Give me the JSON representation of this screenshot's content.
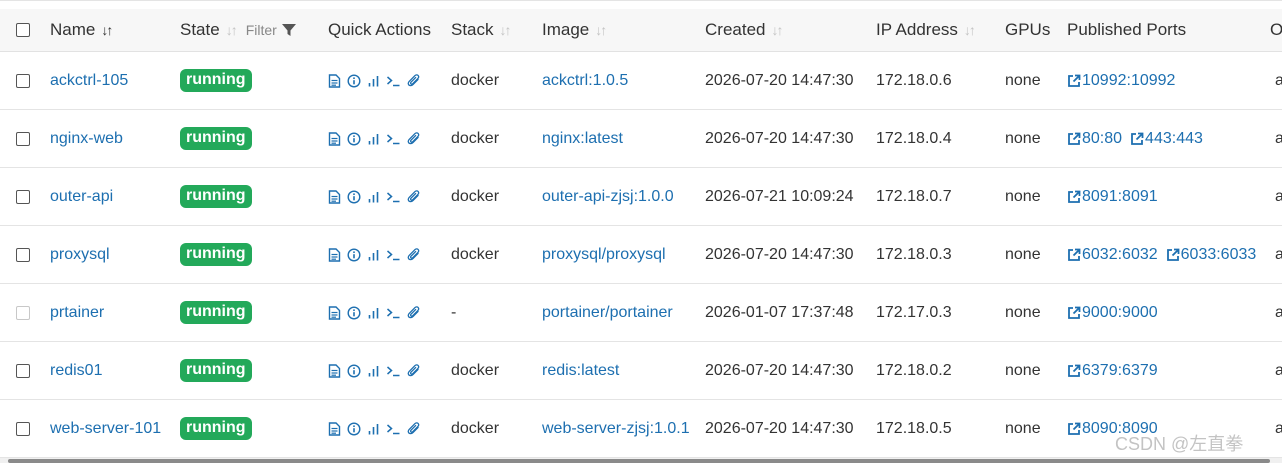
{
  "columns": {
    "name": "Name",
    "state": "State",
    "filter": "Filter",
    "quick_actions": "Quick Actions",
    "stack": "Stack",
    "image": "Image",
    "created": "Created",
    "ip": "IP Address",
    "gpus": "GPUs",
    "ports": "Published Ports",
    "owner_partial": "O"
  },
  "rows": [
    {
      "name": "ackctrl-105",
      "state": "running",
      "stack": "docker",
      "image": "ackctrl:1.0.5",
      "created": "2026-07-20 14:47:30",
      "ip": "172.18.0.6",
      "gpus": "none",
      "ports": [
        "10992:10992"
      ],
      "owner_partial": "a"
    },
    {
      "name": "nginx-web",
      "state": "running",
      "stack": "docker",
      "image": "nginx:latest",
      "created": "2026-07-20 14:47:30",
      "ip": "172.18.0.4",
      "gpus": "none",
      "ports": [
        "80:80",
        "443:443"
      ],
      "owner_partial": "a"
    },
    {
      "name": "outer-api",
      "state": "running",
      "stack": "docker",
      "image": "outer-api-zjsj:1.0.0",
      "created": "2026-07-21 10:09:24",
      "ip": "172.18.0.7",
      "gpus": "none",
      "ports": [
        "8091:8091"
      ],
      "owner_partial": "a"
    },
    {
      "name": "proxysql",
      "state": "running",
      "stack": "docker",
      "image": "proxysql/proxysql",
      "created": "2026-07-20 14:47:30",
      "ip": "172.18.0.3",
      "gpus": "none",
      "ports": [
        "6032:6032",
        "6033:6033"
      ],
      "owner_partial": "a"
    },
    {
      "name": "prtainer",
      "state": "running",
      "stack": "-",
      "image": "portainer/portainer",
      "created": "2026-01-07 17:37:48",
      "ip": "172.17.0.3",
      "gpus": "none",
      "ports": [
        "9000:9000"
      ],
      "owner_partial": "a",
      "checkbox_disabled": true
    },
    {
      "name": "redis01",
      "state": "running",
      "stack": "docker",
      "image": "redis:latest",
      "created": "2026-07-20 14:47:30",
      "ip": "172.18.0.2",
      "gpus": "none",
      "ports": [
        "6379:6379"
      ],
      "owner_partial": "a"
    },
    {
      "name": "web-server-101",
      "state": "running",
      "stack": "docker",
      "image": "web-server-zjsj:1.0.1",
      "created": "2026-07-20 14:47:30",
      "ip": "172.18.0.5",
      "gpus": "none",
      "ports": [
        "8090:8090"
      ],
      "owner_partial": "a"
    }
  ],
  "quick_action_icons": [
    "logs-icon",
    "inspect-icon",
    "stats-icon",
    "console-icon",
    "attach-icon"
  ],
  "watermark": "CSDN @左直拳",
  "colors": {
    "link": "#1d6fb0",
    "running_badge": "#23a95a"
  }
}
